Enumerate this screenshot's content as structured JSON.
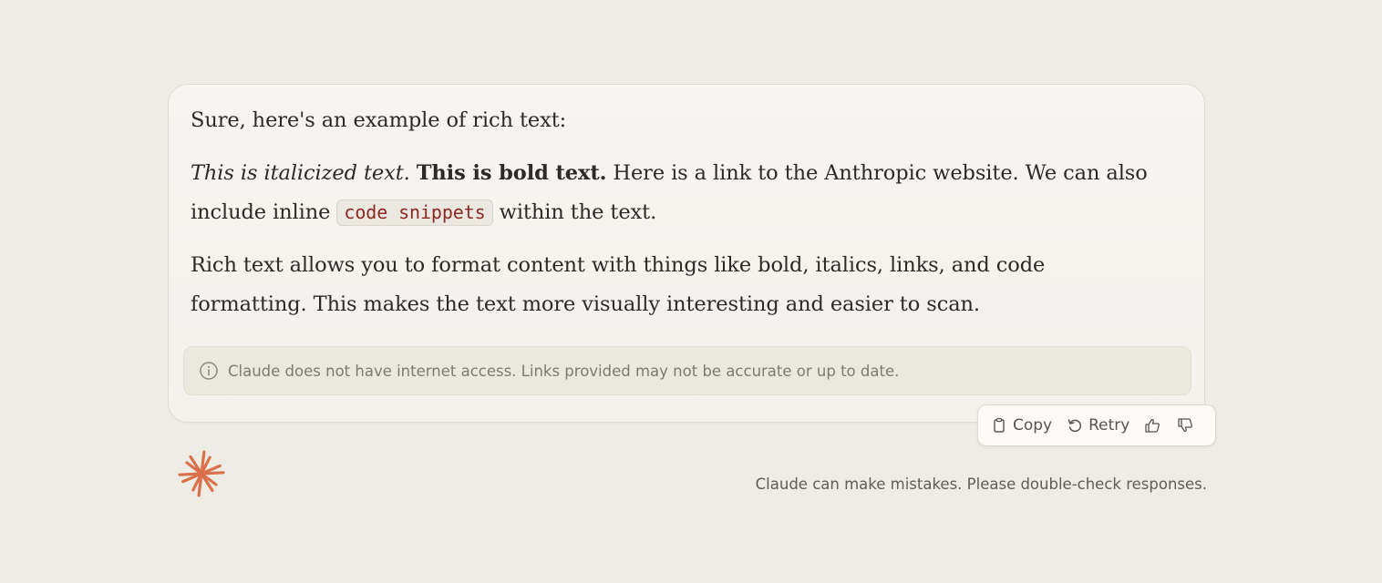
{
  "message": {
    "intro": "Sure, here's an example of rich text:",
    "italic_text": "This is italicized text.",
    "bold_text": "This is bold text.",
    "link_sentence": " Here is a link to the Anthropic website. We can also include inline ",
    "code_snippet": "code snippets",
    "after_code": " within the text.",
    "summary": "Rich text allows you to format content with things like bold, italics, links, and code formatting. This makes the text more visually interesting and easier to scan."
  },
  "disclaimer": {
    "icon": "info-icon",
    "text": "Claude does not have internet access. Links provided may not be accurate or up to date."
  },
  "actions": {
    "copy_label": "Copy",
    "retry_label": "Retry",
    "thumbs_up_icon": "thumbs-up-icon",
    "thumbs_down_icon": "thumbs-down-icon"
  },
  "footer": {
    "note": "Claude can make mistakes. Please double-check responses."
  },
  "colors": {
    "background": "#efece5",
    "card": "#f5f4f0",
    "text": "#2b2a27",
    "code_text": "#8a2a22",
    "brand": "#d9714c"
  }
}
